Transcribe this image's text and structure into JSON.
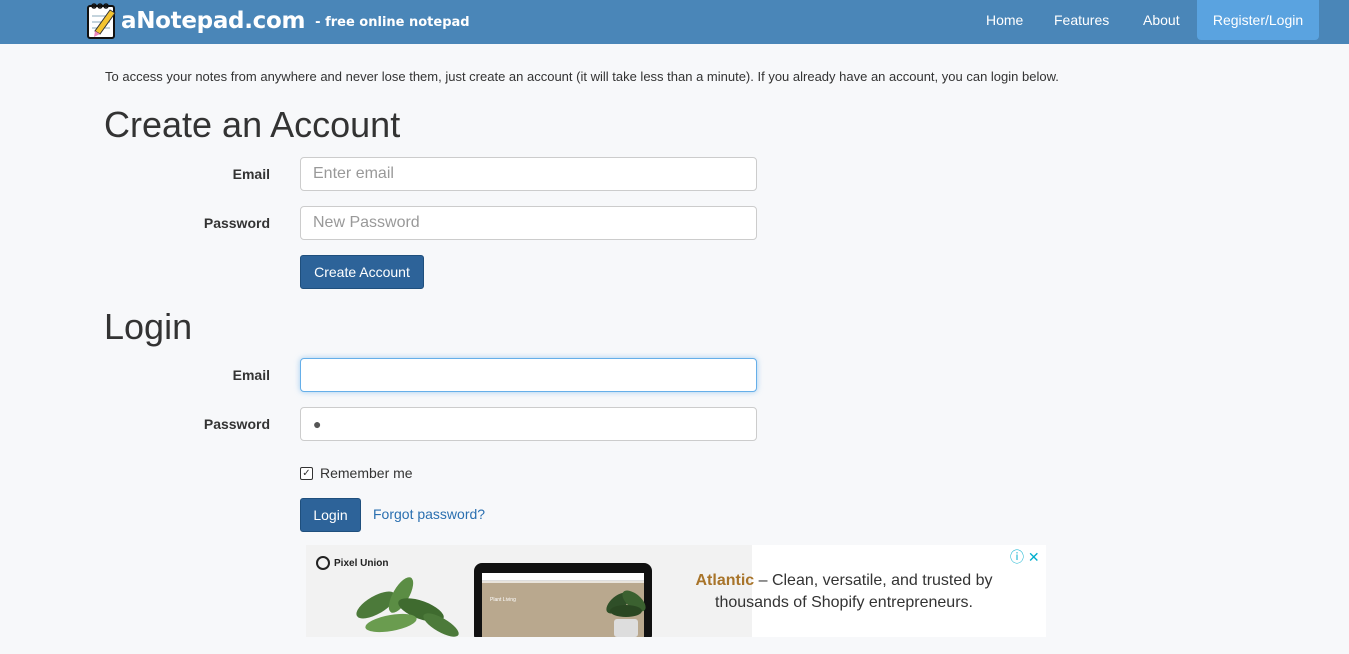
{
  "header": {
    "brand_name": "aNotepad.com",
    "tagline": "- free online notepad",
    "nav": {
      "home": "Home",
      "features": "Features",
      "about": "About",
      "register_login": "Register/Login"
    }
  },
  "intro_text": "To access your notes from anywhere and never lose them, just create an account (it will take less than a minute). If you already have an account, you can login below.",
  "create_account": {
    "title": "Create an Account",
    "email_label": "Email",
    "email_placeholder": "Enter email",
    "password_label": "Password",
    "password_placeholder": "New Password",
    "submit_label": "Create Account"
  },
  "login": {
    "title": "Login",
    "email_label": "Email",
    "email_value": "",
    "password_label": "Password",
    "password_mask": "●",
    "remember_label": "Remember me",
    "remember_checked": true,
    "checkbox_glyph": "✓",
    "submit_label": "Login",
    "forgot_label": "Forgot password?"
  },
  "ad": {
    "brand": "Pixel Union",
    "screen_text": "Plant Living",
    "headline_accent": "Atlantic",
    "headline_rest": " – Clean, versatile, and trusted by thousands of Shopify entrepreneurs.",
    "icons": "ⓘ ✕"
  },
  "colors": {
    "navbar": "#4a86b8",
    "register_button": "#5aa3e0",
    "primary_button": "#2d6399",
    "link": "#2a6fb0",
    "ad_accent": "#a8742a"
  }
}
